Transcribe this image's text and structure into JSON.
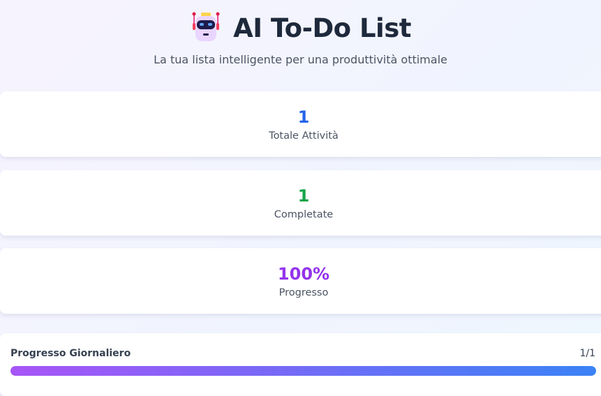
{
  "header": {
    "title": "AI To-Do List",
    "subtitle": "La tua lista intelligente per una produttività ottimale",
    "logo_icon": "robot-icon"
  },
  "stats": [
    {
      "value": "1",
      "label": "Totale Attività",
      "color": "#2563eb"
    },
    {
      "value": "1",
      "label": "Completate",
      "color": "#16a34a"
    },
    {
      "value": "100%",
      "label": "Progresso",
      "color": "#9333ea"
    }
  ],
  "daily_progress": {
    "title": "Progresso Giornaliero",
    "count": "1/1",
    "percent": 100
  }
}
